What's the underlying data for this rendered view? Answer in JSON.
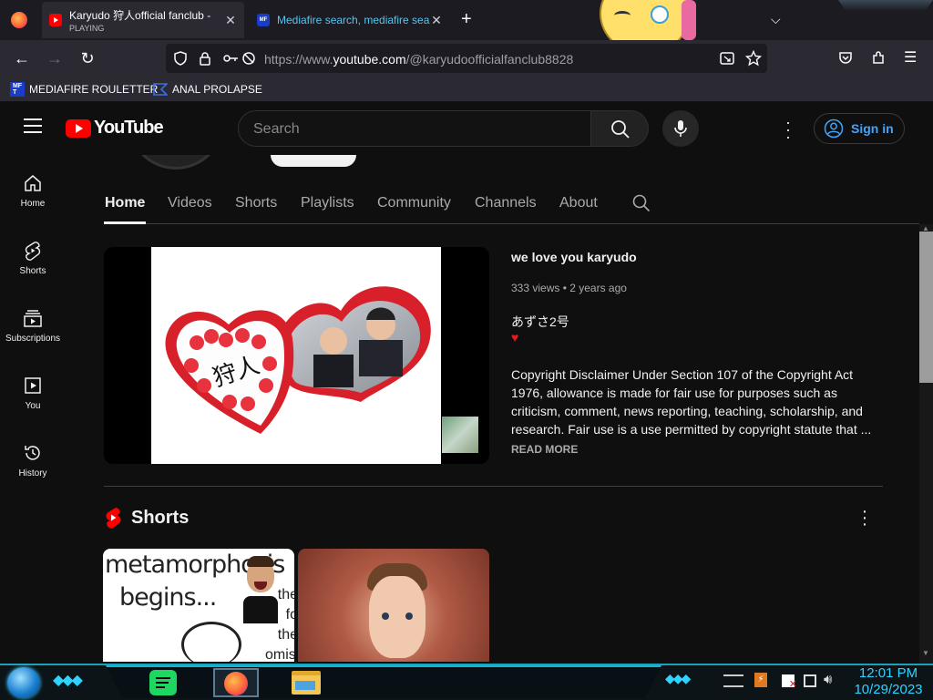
{
  "browser": {
    "tabs": [
      {
        "title": "Karyudo 狩人official fanclub -",
        "subtitle": "PLAYING",
        "active": true
      },
      {
        "title": "Mediafire search, mediafire sea",
        "active": false
      }
    ],
    "url_prefix": "https://www.",
    "url_domain": "youtube.com",
    "url_path": "/@karyudoofficialfanclub8828",
    "bookmarks": [
      {
        "label": "MEDIAFIRE ROULETTER",
        "icon": "mediafire-icon",
        "icon_text": "MF T"
      },
      {
        "label": "ANAL PROLAPSE",
        "icon": "bookmark-flag-icon"
      }
    ]
  },
  "youtube": {
    "logo_text": "YouTube",
    "search_placeholder": "Search",
    "signin_label": "Sign in",
    "sidebar": [
      {
        "label": "Home",
        "icon": "home-icon"
      },
      {
        "label": "Shorts",
        "icon": "shorts-icon"
      },
      {
        "label": "Subscriptions",
        "icon": "subscriptions-icon"
      },
      {
        "label": "You",
        "icon": "you-icon"
      },
      {
        "label": "History",
        "icon": "history-icon"
      }
    ],
    "channel_tabs": [
      "Home",
      "Videos",
      "Shorts",
      "Playlists",
      "Community",
      "Channels",
      "About"
    ],
    "active_tab": "Home",
    "featured": {
      "title": "we love you karyudo",
      "views": "333 views",
      "age": "2 years ago",
      "subtitle": "あずさ2号",
      "thumb_text": "狩人",
      "description": "Copyright Disclaimer Under Section 107 of the Copyright Act 1976, allowance is made for fair use for purposes such as criticism, comment, news reporting, teaching, scholarship, and research. Fair use is a use permitted by copyright statute that ...",
      "read_more": "READ MORE"
    },
    "shorts_heading": "Shorts",
    "shorts": [
      {
        "caption_line1": "metamorphosis",
        "caption_line2": "begins...",
        "side_text": "the fo the omise"
      },
      {
        "caption_line1": ""
      }
    ]
  },
  "taskbar": {
    "time": "12:01 PM",
    "date": "10/29/2023",
    "apps": [
      "spotify-icon",
      "firefox-icon",
      "file-explorer-icon"
    ]
  },
  "colors": {
    "yt_red": "#ff0000",
    "link_blue": "#3ea6ff",
    "firefox_bg": "#2b2a33",
    "taskbar_accent": "#2fd3ff"
  }
}
